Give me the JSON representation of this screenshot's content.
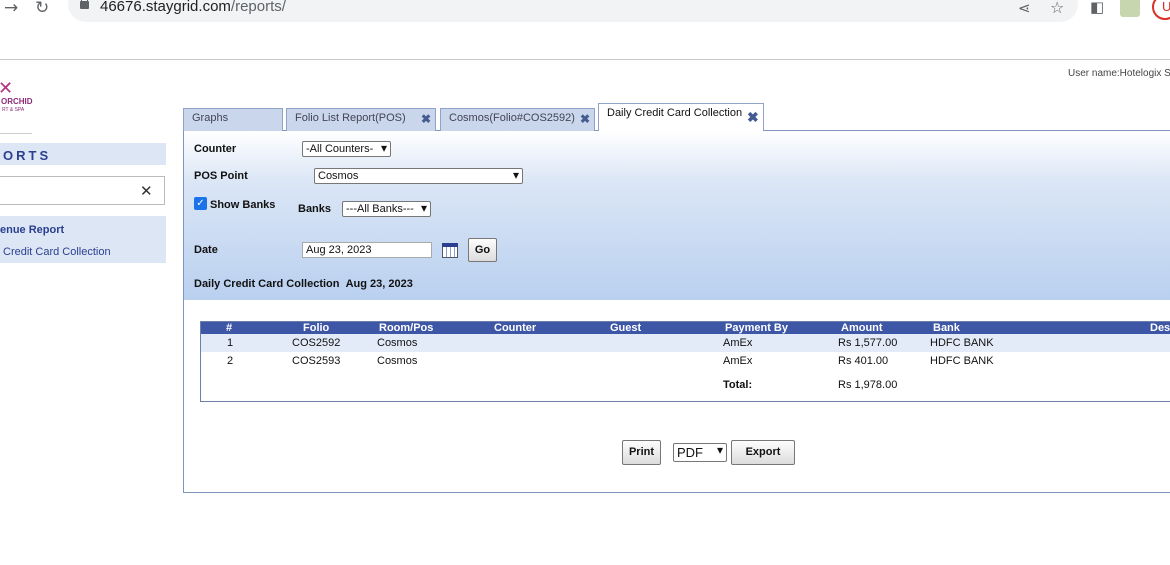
{
  "browser": {
    "back_icon": "arrow-back-icon",
    "reload_icon": "reload-icon",
    "url_host": "46676.staygrid.com",
    "url_path": "/reports/",
    "profile_letter": "U"
  },
  "header": {
    "username": "User name:Hotelogix S"
  },
  "logo": {
    "mark": "✕",
    "text": "ORCHID",
    "sub": "RT & SPA"
  },
  "sidebar": {
    "heading": "ORTS",
    "close_symbol": "✕",
    "items": [
      {
        "label": "enue Report"
      },
      {
        "label": "Credit Card Collection"
      }
    ]
  },
  "tabs": [
    {
      "label": "Graphs"
    },
    {
      "label": "Folio List Report(POS)"
    },
    {
      "label": "Cosmos(Folio#COS2592)"
    },
    {
      "label": "Daily Credit Card Collection"
    }
  ],
  "tab_close_symbol": "✖",
  "filters": {
    "counter_label": "Counter",
    "counter_value": "-All Counters-",
    "pos_label": "POS Point",
    "pos_value": "Cosmos",
    "show_banks_label": "Show Banks",
    "show_banks_checked": true,
    "banks_label": "Banks",
    "banks_value": "---All Banks---",
    "date_label": "Date",
    "date_value": "Aug 23, 2023",
    "go_label": "Go"
  },
  "report": {
    "title": "Daily Credit Card Collection",
    "title_date": "Aug 23, 2023"
  },
  "table": {
    "headers": [
      "#",
      "Folio",
      "Room/Pos",
      "Counter",
      "Guest",
      "Payment By",
      "Amount",
      "Bank",
      "Des"
    ],
    "rows": [
      {
        "no": "1",
        "folio": "COS2592",
        "room": "Cosmos",
        "counter": "",
        "guest": "",
        "payment": "AmEx",
        "amount": "Rs 1,577.00",
        "bank": "HDFC BANK"
      },
      {
        "no": "2",
        "folio": "COS2593",
        "room": "Cosmos",
        "counter": "",
        "guest": "",
        "payment": "AmEx",
        "amount": "Rs 401.00",
        "bank": "HDFC BANK"
      }
    ],
    "total_label": "Total:",
    "total_value": "Rs 1,978.00"
  },
  "actions": {
    "print_label": "Print",
    "format_value": "PDF",
    "export_label": "Export"
  },
  "colors": {
    "header_blue": "#3d56a6",
    "sidebar_bg": "#dde6f5",
    "link_blue": "#2b3f8f"
  }
}
